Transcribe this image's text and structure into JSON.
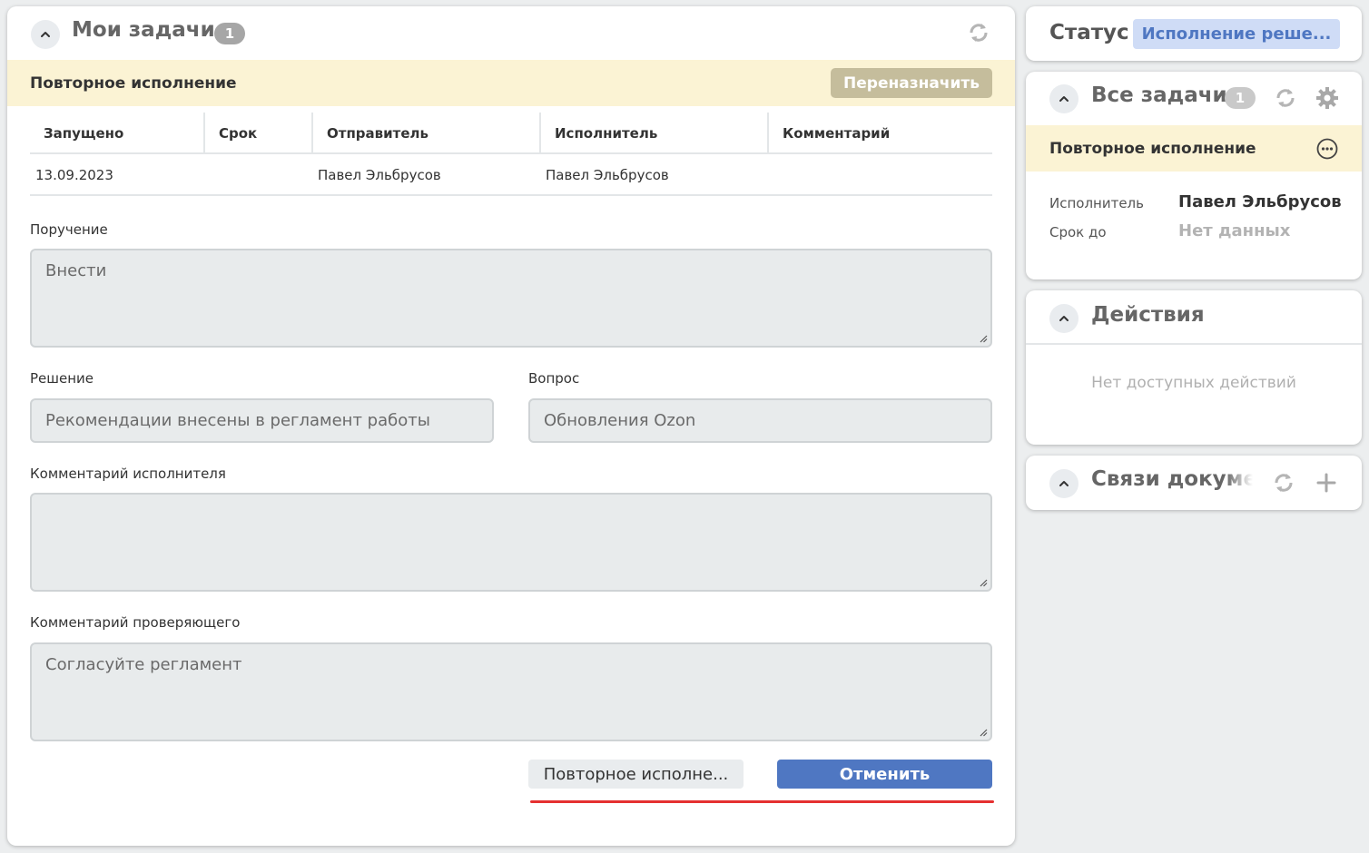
{
  "main": {
    "title": "Мои задачи",
    "count": "1",
    "task_type": "Повторное исполнение",
    "reassign_label": "Переназначить",
    "table": {
      "headers": [
        "Запущено",
        "Срок",
        "Отправитель",
        "Исполнитель",
        "Комментарий"
      ],
      "row": [
        "13.09.2023",
        "",
        "Павел Эльбрусов",
        "Павел Эльбрусов",
        ""
      ]
    },
    "fields": {
      "assignment": {
        "label": "Поручение",
        "value": "Внести"
      },
      "decision": {
        "label": "Решение",
        "value": "Рекомендации внесены в регламент работы"
      },
      "question": {
        "label": "Вопрос",
        "value": "Обновления Ozon"
      },
      "executor_comment": {
        "label": "Комментарий исполнителя",
        "value": ""
      },
      "reviewer_comment": {
        "label": "Комментарий проверяющего",
        "value": "Согласуйте регламент"
      }
    },
    "buttons": {
      "repeat": "Повторное исполне...",
      "cancel": "Отменить"
    }
  },
  "status": {
    "label": "Статус",
    "value": "Исполнение реше..."
  },
  "all_tasks": {
    "title": "Все задачи",
    "count": "1",
    "task_type": "Повторное исполнение",
    "executor_label": "Исполнитель",
    "executor_value": "Павел Эльбрусов",
    "due_label": "Срок до",
    "due_value": "Нет данных"
  },
  "actions": {
    "title": "Действия",
    "empty": "Нет доступных действий"
  },
  "links": {
    "title": "Связи документа"
  },
  "colors": {
    "primary": "#4f77c2",
    "highlight_strip": "#fbf3d4",
    "reassign": "#c5bd9c",
    "status_pill": "#cfdcf6",
    "annotation": "#e53030"
  },
  "icons": [
    "chevron-up-icon",
    "refresh-icon",
    "gear-icon",
    "more-horizontal-icon",
    "plus-icon",
    "resize-grip-icon"
  ]
}
